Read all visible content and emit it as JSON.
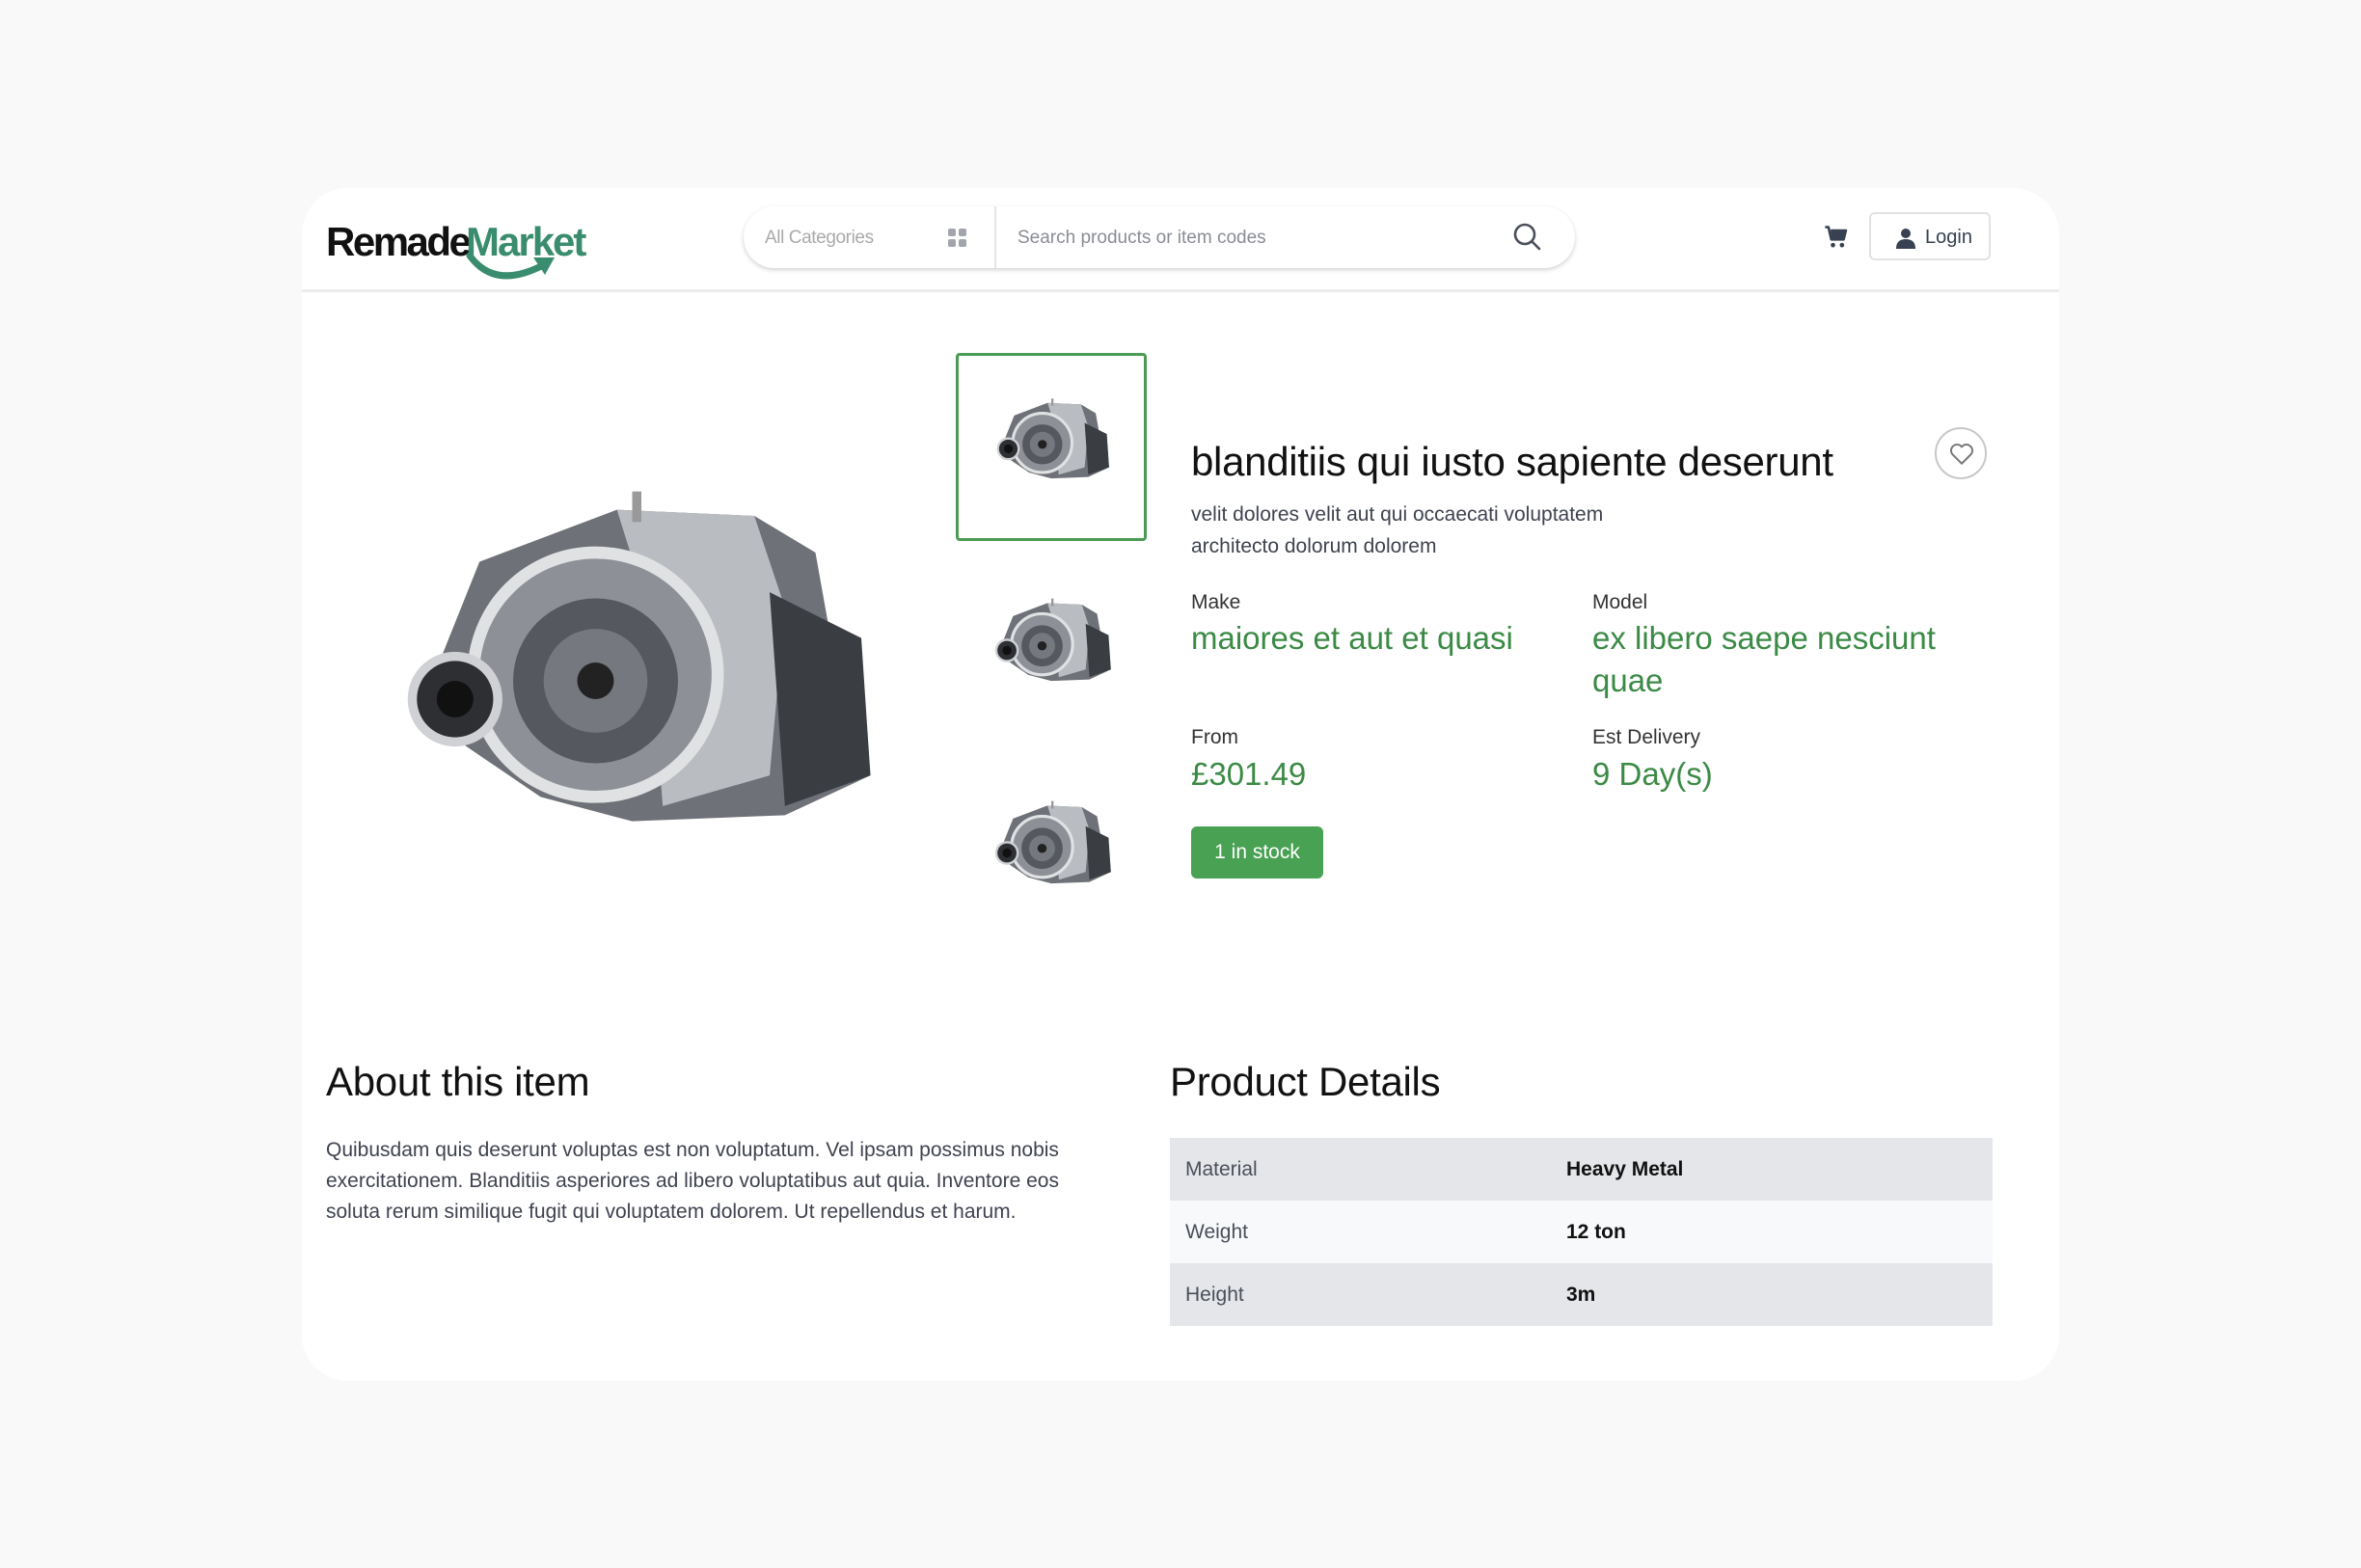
{
  "header": {
    "logo": {
      "part1": "Remade",
      "part2": "Market"
    },
    "category_select": {
      "label": "All Categories",
      "icon": "grid-icon"
    },
    "search": {
      "placeholder": "Search products or item codes",
      "value": "",
      "icon": "search-icon"
    },
    "cart_icon": "cart-icon",
    "login_label": "Login"
  },
  "product": {
    "title": "blanditiis qui iusto sapiente deserunt",
    "subtitle": "velit dolores velit aut qui occaecati voluptatem architecto dolorum dolorem",
    "make_label": "Make",
    "make": "maiores et aut et quasi",
    "model_label": "Model",
    "model": "ex libero saepe nesciunt quae",
    "from_label": "From",
    "price": "£301.49",
    "delivery_label": "Est Delivery",
    "delivery": "9 Day(s)",
    "stock": "1 in stock",
    "thumbnails": [
      {
        "selected": true
      },
      {
        "selected": false
      },
      {
        "selected": false
      }
    ]
  },
  "about": {
    "heading": "About this item",
    "text": "Quibusdam quis deserunt voluptas est non voluptatum. Vel ipsam possimus nobis exercitationem. Blanditiis asperiores ad libero voluptatibus aut quia. Inventore eos soluta rerum similique fugit qui voluptatem dolorem. Ut repellendus et harum."
  },
  "details": {
    "heading": "Product Details",
    "rows": [
      {
        "key": "Material",
        "value": "Heavy Metal"
      },
      {
        "key": "Weight",
        "value": "12 ton"
      },
      {
        "key": "Height",
        "value": "3m"
      }
    ]
  },
  "colors": {
    "accent": "#3b8a45",
    "stock_bg": "#49a153",
    "logo_green": "#3a8c6e"
  }
}
